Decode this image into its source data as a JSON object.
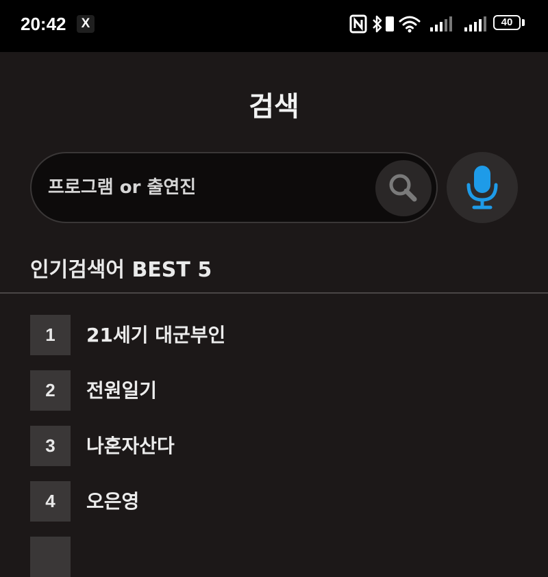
{
  "status_bar": {
    "time": "20:42",
    "notification_app": "X",
    "battery_level": "40",
    "icons": [
      "nfc-icon",
      "bluetooth-icon",
      "wifi-icon",
      "signal-icon",
      "signal-icon",
      "battery-icon"
    ]
  },
  "header": {
    "title": "검색"
  },
  "search": {
    "placeholder": "프로그램 or 출연진",
    "value": "",
    "search_icon": "search-icon",
    "mic_icon": "mic-icon"
  },
  "colors": {
    "mic_accent": "#1e9be8",
    "background": "#1c1818"
  },
  "popular": {
    "title": "인기검색어 BEST 5",
    "items": [
      {
        "rank": "1",
        "label": "21세기 대군부인"
      },
      {
        "rank": "2",
        "label": "전원일기"
      },
      {
        "rank": "3",
        "label": "나혼자산다"
      },
      {
        "rank": "4",
        "label": "오은영"
      }
    ]
  }
}
